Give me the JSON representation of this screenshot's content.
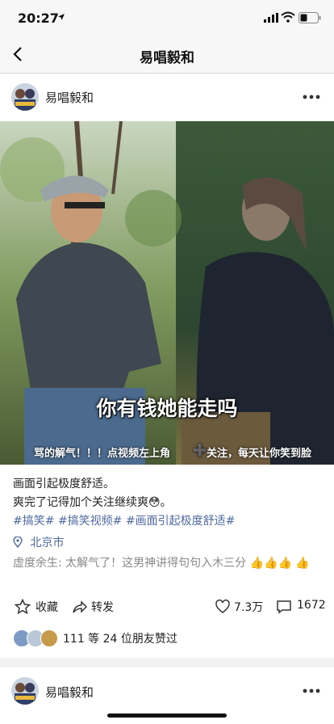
{
  "status": {
    "time": "20:27"
  },
  "nav": {
    "title": "易唱毅和"
  },
  "post": {
    "author": "易唱毅和",
    "avatar_text": "易唱毅和",
    "video_caption": "你有钱她能走吗",
    "video_ticker": [
      "骂的解气！！！点视频左上角",
      "关注，每天让你笑到脸"
    ],
    "text_lines": [
      "画面引起极度舒适。",
      "爽完了记得加个关注继续爽😳。"
    ],
    "tags": [
      "#搞笑#",
      "#搞笑视频#",
      "#画面引起极度舒适#"
    ],
    "location": "北京市",
    "comment": {
      "user": "虚度余生:",
      "text": "太解气了！这男神讲得句句入木三分"
    },
    "actions": {
      "collect": "收藏",
      "share": "转发",
      "likes": "7.3万",
      "comments": "1672"
    },
    "liked_by": "111 等 24 位朋友赞过"
  },
  "next_post": {
    "author": "易唱毅和"
  }
}
